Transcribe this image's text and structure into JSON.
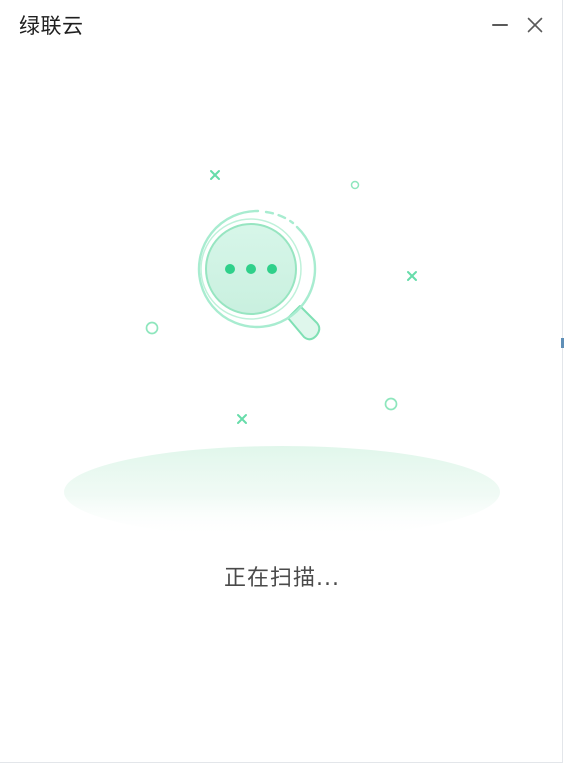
{
  "window": {
    "title": "绿联云"
  },
  "controls": {
    "minimize_icon": "minimize-icon",
    "close_icon": "close-icon"
  },
  "scan": {
    "status": "正在扫描..."
  },
  "colors": {
    "accent": "#2fd08a",
    "accent_light": "#dff7ec",
    "accent_line": "#8ee6bd",
    "text": "#4a4a4a"
  }
}
